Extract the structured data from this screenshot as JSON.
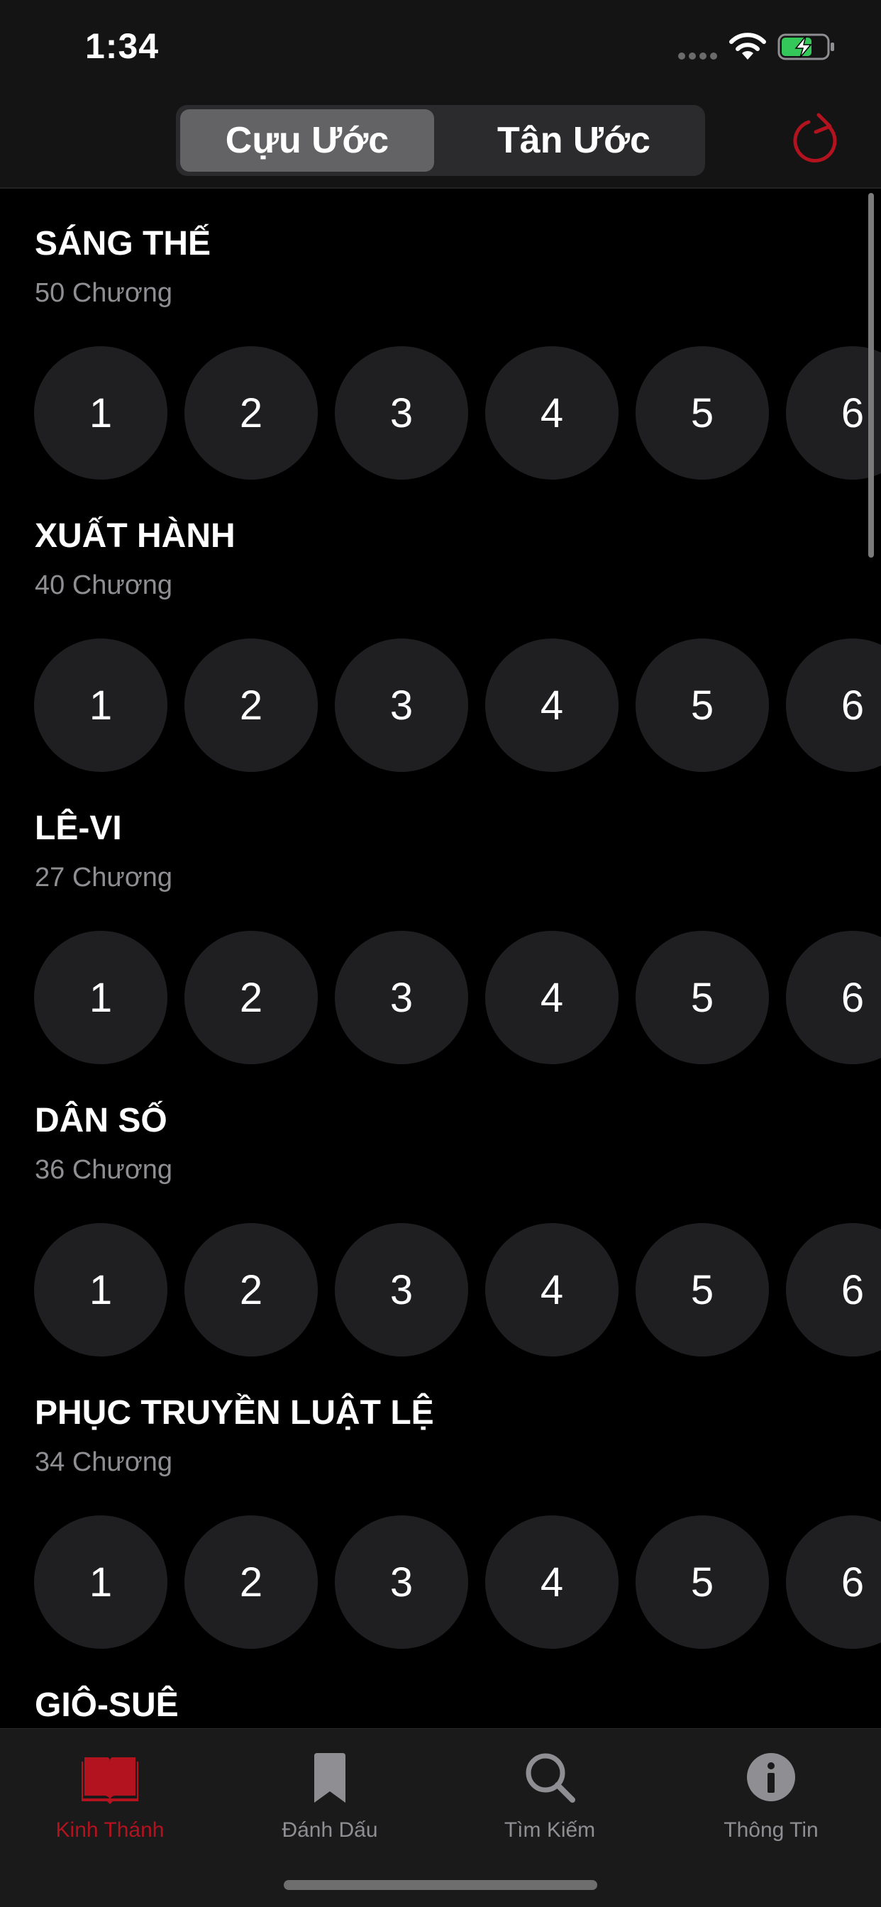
{
  "status_bar": {
    "time": "1:34",
    "icons": [
      "signal-dots-icon",
      "wifi-icon",
      "battery-charging-icon"
    ]
  },
  "header": {
    "segments": [
      {
        "label": "Cựu Ước",
        "selected": true
      },
      {
        "label": "Tân Ước",
        "selected": false
      }
    ],
    "refresh_icon": "refresh-icon",
    "accent_color": "#b3121f"
  },
  "books": [
    {
      "title": "SÁNG THẾ",
      "count": "50 Chương",
      "chapters": [
        "1",
        "2",
        "3",
        "4",
        "5",
        "6"
      ]
    },
    {
      "title": "XUẤT HÀNH",
      "count": "40 Chương",
      "chapters": [
        "1",
        "2",
        "3",
        "4",
        "5",
        "6"
      ]
    },
    {
      "title": "LÊ-VI",
      "count": "27 Chương",
      "chapters": [
        "1",
        "2",
        "3",
        "4",
        "5",
        "6"
      ]
    },
    {
      "title": "DÂN SỐ",
      "count": "36 Chương",
      "chapters": [
        "1",
        "2",
        "3",
        "4",
        "5",
        "6"
      ]
    },
    {
      "title": "PHỤC TRUYỀN LUẬT LỆ",
      "count": "34 Chương",
      "chapters": [
        "1",
        "2",
        "3",
        "4",
        "5",
        "6"
      ]
    },
    {
      "title": "GIÔ-SUÊ"
    }
  ],
  "tab_bar": {
    "tabs": [
      {
        "label": "Kinh Thánh",
        "icon": "book-icon",
        "active": true
      },
      {
        "label": "Đánh Dấu",
        "icon": "bookmark-icon",
        "active": false
      },
      {
        "label": "Tìm Kiếm",
        "icon": "search-icon",
        "active": false
      },
      {
        "label": "Thông Tin",
        "icon": "info-icon",
        "active": false
      }
    ]
  }
}
